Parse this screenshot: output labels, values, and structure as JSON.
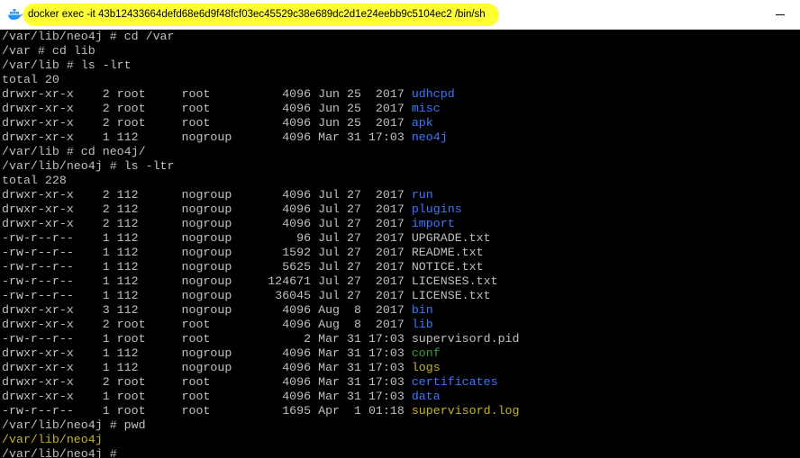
{
  "window": {
    "title": "docker  exec -it 43b12433664defd68e6d9f48fcf03ec45529c38e689dc2d1e24eebb9c5104ec2 /bin/sh",
    "icon": "docker-whale-icon",
    "highlight_color": "#ffff33"
  },
  "colors": {
    "background": "#000000",
    "text": "#c0c0c0",
    "directory": "#3a78ff",
    "green": "#3a9a3a",
    "olive": "#c8b41e"
  },
  "terminal": {
    "lines": [
      {
        "text": "/var/lib/neo4j # cd /var"
      },
      {
        "text": "/var # cd lib"
      },
      {
        "text": "/var/lib # ls -lrt"
      },
      {
        "text": "total 20"
      },
      {
        "text": "drwxr-xr-x    2 root     root          4096 Jun 25  2017 ",
        "name": "udhcpd",
        "color": "dir"
      },
      {
        "text": "drwxr-xr-x    2 root     root          4096 Jun 25  2017 ",
        "name": "misc",
        "color": "dir"
      },
      {
        "text": "drwxr-xr-x    2 root     root          4096 Jun 25  2017 ",
        "name": "apk",
        "color": "dir"
      },
      {
        "text": "drwxr-xr-x    1 112      nogroup       4096 Mar 31 17:03 ",
        "name": "neo4j",
        "color": "dir"
      },
      {
        "text": "/var/lib # cd neo4j/"
      },
      {
        "text": "/var/lib/neo4j # ls -ltr"
      },
      {
        "text": "total 228"
      },
      {
        "text": "drwxr-xr-x    2 112      nogroup       4096 Jul 27  2017 ",
        "name": "run",
        "color": "dir"
      },
      {
        "text": "drwxr-xr-x    2 112      nogroup       4096 Jul 27  2017 ",
        "name": "plugins",
        "color": "dir"
      },
      {
        "text": "drwxr-xr-x    2 112      nogroup       4096 Jul 27  2017 ",
        "name": "import",
        "color": "dir"
      },
      {
        "text": "-rw-r--r--    1 112      nogroup         96 Jul 27  2017 ",
        "name": "UPGRADE.txt",
        "color": "text"
      },
      {
        "text": "-rw-r--r--    1 112      nogroup       1592 Jul 27  2017 ",
        "name": "README.txt",
        "color": "text"
      },
      {
        "text": "-rw-r--r--    1 112      nogroup       5625 Jul 27  2017 ",
        "name": "NOTICE.txt",
        "color": "text"
      },
      {
        "text": "-rw-r--r--    1 112      nogroup     124671 Jul 27  2017 ",
        "name": "LICENSES.txt",
        "color": "text"
      },
      {
        "text": "-rw-r--r--    1 112      nogroup      36045 Jul 27  2017 ",
        "name": "LICENSE.txt",
        "color": "text"
      },
      {
        "text": "drwxr-xr-x    3 112      nogroup       4096 Aug  8  2017 ",
        "name": "bin",
        "color": "dir"
      },
      {
        "text": "drwxr-xr-x    2 root     root          4096 Aug  8  2017 ",
        "name": "lib",
        "color": "dir"
      },
      {
        "text": "-rw-r--r--    1 root     root             2 Mar 31 17:03 ",
        "name": "supervisord.pid",
        "color": "text"
      },
      {
        "text": "drwxr-xr-x    1 112      nogroup       4096 Mar 31 17:03 ",
        "name": "conf",
        "color": "green"
      },
      {
        "text": "drwxr-xr-x    1 112      nogroup       4096 Mar 31 17:03 ",
        "name": "logs",
        "color": "olive"
      },
      {
        "text": "drwxr-xr-x    2 root     root          4096 Mar 31 17:03 ",
        "name": "certificates",
        "color": "dir"
      },
      {
        "text": "drwxr-xr-x    1 root     root          4096 Mar 31 17:03 ",
        "name": "data",
        "color": "dir"
      },
      {
        "text": "-rw-r--r--    1 root     root          1695 Apr  1 01:18 ",
        "name": "supervisord.log",
        "color": "olive"
      },
      {
        "text": "/var/lib/neo4j # pwd"
      },
      {
        "text": "/var/lib/neo4j",
        "color": "olive"
      },
      {
        "text": "/var/lib/neo4j # "
      }
    ]
  }
}
